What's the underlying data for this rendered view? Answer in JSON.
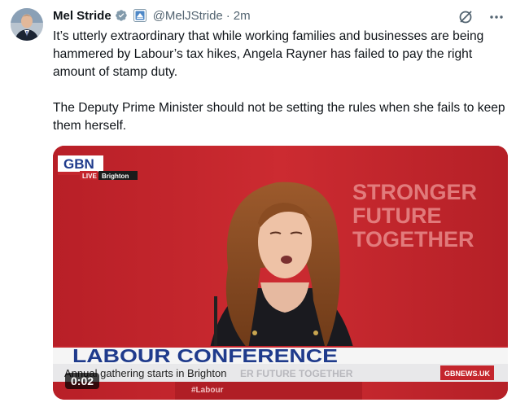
{
  "author": {
    "name": "Mel Stride",
    "handle": "@MelJStride",
    "separator": "·",
    "time": "2m"
  },
  "tweet": {
    "paragraph1": "It’s utterly extraordinary that while working families and businesses are being hammered by Labour’s tax hikes, Angela Rayner has failed to pay the right amount of stamp duty.",
    "paragraph2": "The Deputy Prime Minister should not be setting the rules when she fails to keep them herself."
  },
  "video": {
    "channel_logo": "GBN",
    "live_label": "LIVE",
    "location": "Brighton",
    "podium_text": [
      "STRONGER",
      "FUTURE",
      "TOGETHER"
    ],
    "lower_third_title": "LABOUR CONFERENCE",
    "lower_third_subtitle": "Annual gathering starts in Brighton",
    "background_slogan": "ER FUTURE TOGETHER",
    "lectern_text": "#Labour",
    "site": "GBNEWS.UK",
    "timecode": "0:02"
  },
  "icons": [
    "verified-badge-icon",
    "government-label-icon",
    "grok-icon",
    "more-icon"
  ],
  "colors": {
    "stage_red": "#c4262d",
    "verified_gray": "#829aab",
    "handle_gray": "#536471",
    "gbn_blue": "#1f3b8c"
  }
}
